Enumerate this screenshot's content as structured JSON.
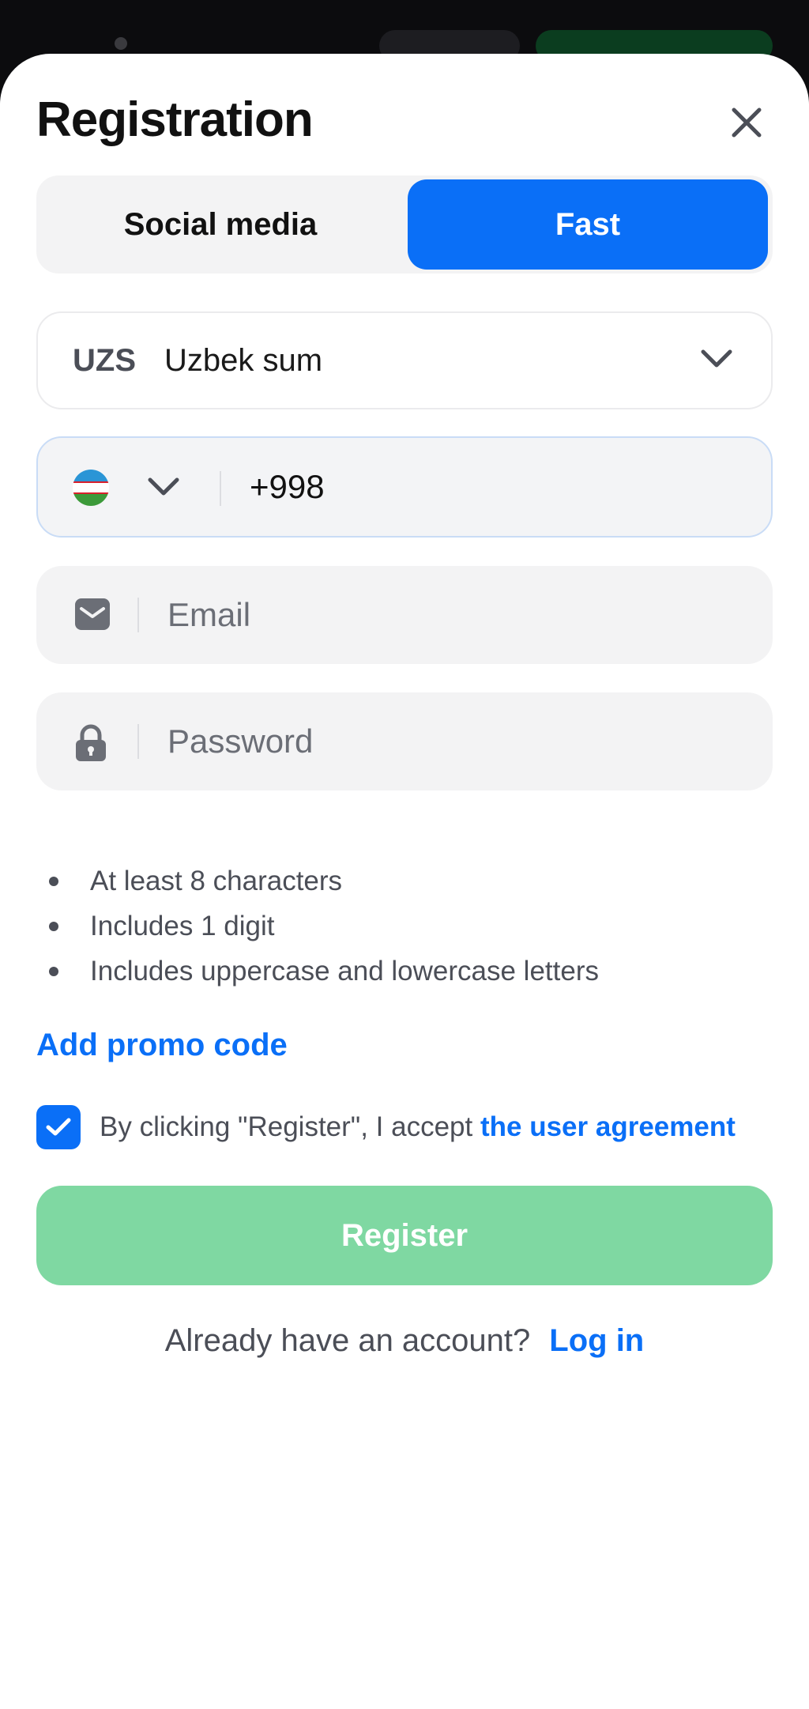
{
  "header": {
    "title": "Registration",
    "close_icon": "close-icon"
  },
  "tabs": [
    {
      "label": "Social media",
      "active": false
    },
    {
      "label": "Fast",
      "active": true
    }
  ],
  "currency": {
    "code": "UZS",
    "name": "Uzbek sum",
    "icon": "chevron-down-icon"
  },
  "phone": {
    "country_flag": "uzbekistan-flag-icon",
    "value": "+998"
  },
  "email": {
    "placeholder": "Email",
    "icon": "envelope-icon"
  },
  "password": {
    "placeholder": "Password",
    "icon": "lock-icon"
  },
  "password_rules": [
    "At least 8 characters",
    "Includes 1 digit",
    "Includes uppercase and lowercase letters"
  ],
  "promo_label": "Add promo code",
  "agreement": {
    "checked": true,
    "text": "By clicking \"Register\", I accept ",
    "link": "the user agreement"
  },
  "register_label": "Register",
  "login": {
    "question": "Already have an account?",
    "link": "Log in"
  },
  "colors": {
    "accent": "#0a6ff7",
    "register_disabled": "#7fd8a2",
    "field_bg": "#f3f3f4"
  }
}
